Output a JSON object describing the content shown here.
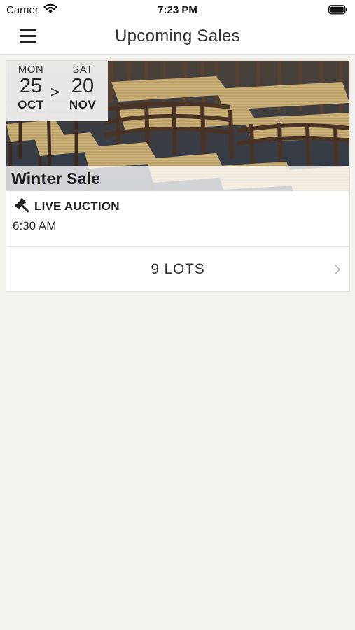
{
  "status_bar": {
    "carrier": "Carrier",
    "time": "7:23 PM"
  },
  "nav": {
    "title": "Upcoming Sales"
  },
  "sale": {
    "start": {
      "dow": "MON",
      "day": "25",
      "month": "OCT"
    },
    "separator": ">",
    "end": {
      "dow": "SAT",
      "day": "20",
      "month": "NOV"
    },
    "title": "Winter Sale",
    "auction_type": "LIVE AUCTION",
    "time": "6:30 AM",
    "lots_label": "9 LOTS"
  },
  "icons": {
    "menu": "hamburger-icon",
    "gavel": "gavel-icon",
    "chevron": "chevron-right-icon",
    "wifi": "wifi-icon",
    "battery": "battery-icon"
  },
  "colors": {
    "background": "#f3f2ef",
    "card": "#ffffff",
    "text": "#222222"
  }
}
